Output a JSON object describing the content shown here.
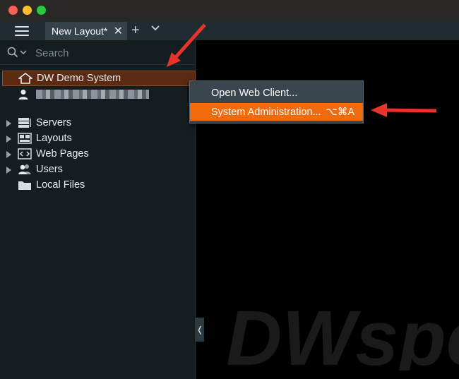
{
  "tabs": [
    {
      "label": "New Layout*"
    }
  ],
  "search": {
    "placeholder": "Search"
  },
  "tree": {
    "system": {
      "label": "DW Demo System"
    },
    "items": [
      {
        "label": "Servers"
      },
      {
        "label": "Layouts"
      },
      {
        "label": "Web Pages"
      },
      {
        "label": "Users"
      },
      {
        "label": "Local Files"
      }
    ]
  },
  "context_menu": {
    "items": [
      {
        "label": "Open Web Client...",
        "shortcut": ""
      },
      {
        "label": "System Administration...",
        "shortcut": "⌥⌘A"
      }
    ]
  },
  "colors": {
    "accent": "#f06b0e",
    "selection": "#5b2a12",
    "sidebar": "#161d21"
  },
  "watermark": {
    "text": "DWspec"
  }
}
